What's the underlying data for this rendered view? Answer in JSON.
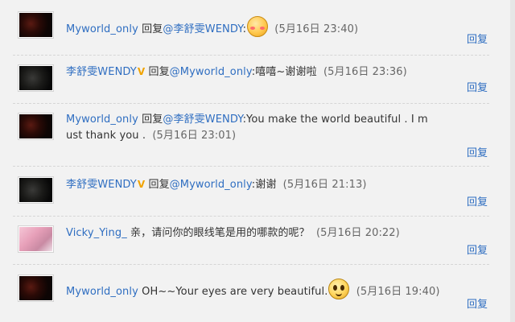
{
  "reply_label": "回复",
  "comments": [
    {
      "user": "Myworld_only",
      "verb": "回复",
      "mention": "@李舒雯WENDY",
      "colon": ":",
      "text": "",
      "emoji": "blush-icon",
      "time": "(5月16日  23:40)"
    },
    {
      "user": "李舒雯WENDY",
      "badge": "V",
      "verb": "回复",
      "mention": "@Myworld_only",
      "colon": ":",
      "text": "嘻嘻~谢谢啦",
      "time": "(5月16日  23:36)"
    },
    {
      "user": "Myworld_only",
      "verb": "回复",
      "mention": "@李舒雯WENDY",
      "colon": ":",
      "text": "You make the world beautiful . I m",
      "text2": "ust thank you .",
      "time": "(5月16日  23:01)"
    },
    {
      "user": "李舒雯WENDY",
      "badge": "V",
      "verb": "回复",
      "mention": "@Myworld_only",
      "colon": ":",
      "text": "谢谢",
      "time": "(5月16日  21:13)"
    },
    {
      "user": "Vicky_Ying_",
      "text": "亲，请问你的眼线笔是用的哪款的呢？",
      "time": "(5月16日  20:22)"
    },
    {
      "user": "Myworld_only",
      "text": "OH~~Your eyes are very beautiful.",
      "emoji": "smile-icon",
      "time": "(5月16日  19:40)"
    }
  ]
}
